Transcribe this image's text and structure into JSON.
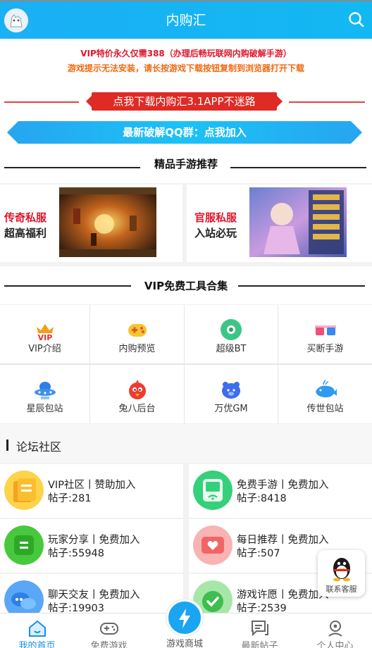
{
  "header": {
    "title": "内购汇"
  },
  "notice": {
    "line1": "VIP特价永久仅需388（办理后畅玩联网内购破解手游）",
    "line2": "游戏提示无法安装，请长按游戏下载按钮复制到浏览器打开下载"
  },
  "download_button": "点我下载内购汇3.1APP不迷路",
  "qq_group_button": "最新破解QQ群：点我加入",
  "section_featured": {
    "title": "精品手游推荐"
  },
  "promos": [
    {
      "red": "传奇私服",
      "black": "超高福利"
    },
    {
      "red": "官服私服",
      "black": "入站必玩"
    }
  ],
  "section_tools": {
    "title": "VIP免费工具合集"
  },
  "tools": [
    {
      "label": "VIP介绍",
      "icon": "vip-crown-icon"
    },
    {
      "label": "内购预览",
      "icon": "gamepad-icon"
    },
    {
      "label": "超级BT",
      "icon": "disc-icon"
    },
    {
      "label": "买断手游",
      "icon": "3d-glasses-icon"
    },
    {
      "label": "星辰包站",
      "icon": "ufo-icon"
    },
    {
      "label": "兔八后台",
      "icon": "angry-bird-icon"
    },
    {
      "label": "万优GM",
      "icon": "bear-icon"
    },
    {
      "label": "传世包站",
      "icon": "whale-icon"
    }
  ],
  "forum": {
    "title": "论坛社区",
    "items": [
      {
        "name": "VIP社区丨赞助加入",
        "count": "帖子:281",
        "color": "#f8a21b"
      },
      {
        "name": "免费手游丨免费加入",
        "count": "帖子:8418",
        "color": "#2bc36a"
      },
      {
        "name": "玩家分享丨免费加入",
        "count": "帖子:55948",
        "color": "#3ac33e"
      },
      {
        "name": "每日推荐丨免费加入",
        "count": "帖子:507",
        "color": "#f26a6a"
      },
      {
        "name": "聊天交友丨免费加入",
        "count": "帖子:19903",
        "color": "#3a8ef0"
      },
      {
        "name": "游戏许愿丨免费加入",
        "count": "帖子:2539",
        "color": "#48c25a"
      }
    ]
  },
  "customer_service": {
    "label": "联系客服"
  },
  "tabbar": {
    "home": "我的首页",
    "free": "免费游戏",
    "store": "游戏商城",
    "posts": "最新帖子",
    "me": "个人中心"
  }
}
